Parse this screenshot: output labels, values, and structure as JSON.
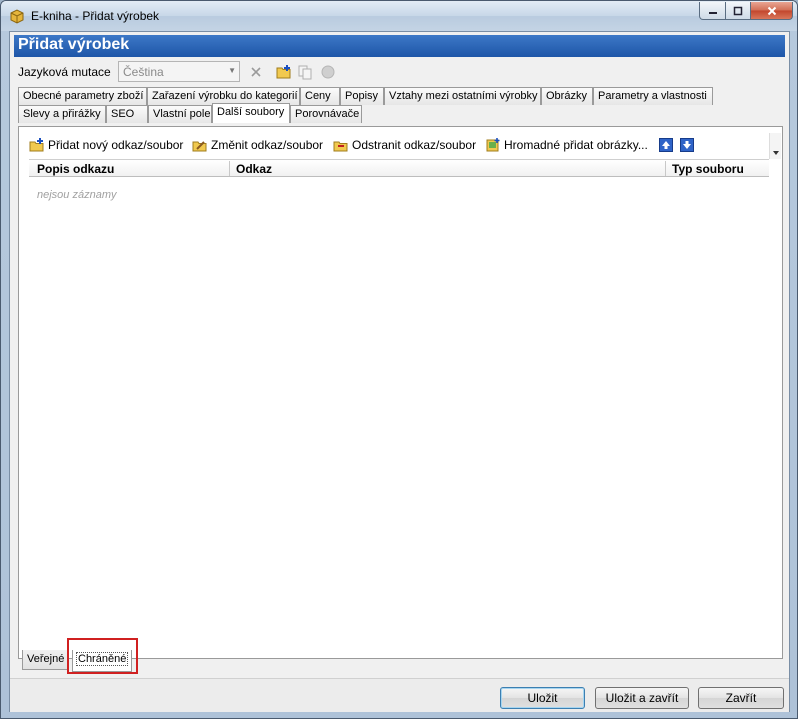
{
  "window": {
    "title": "E-kniha - Přidat výrobek"
  },
  "form": {
    "header": "Přidat výrobek",
    "language_label": "Jazyková mutace",
    "language_value": "Čeština"
  },
  "tabs_row1": [
    {
      "label": "Obecné parametry zboží"
    },
    {
      "label": "Zařazení výrobku do kategorií"
    },
    {
      "label": "Ceny"
    },
    {
      "label": "Popisy"
    },
    {
      "label": "Vztahy mezi ostatními výrobky"
    },
    {
      "label": "Obrázky"
    },
    {
      "label": "Parametry a vlastnosti"
    }
  ],
  "tabs_row2": [
    {
      "label": "Slevy a přirážky"
    },
    {
      "label": "SEO"
    },
    {
      "label": "Vlastní pole"
    },
    {
      "label": "Další soubory"
    },
    {
      "label": "Porovnávače"
    }
  ],
  "active_tab": "Další soubory",
  "toolbar": {
    "add": "Přidat nový odkaz/soubor",
    "edit": "Změnit odkaz/soubor",
    "delete": "Odstranit odkaz/soubor",
    "bulk_add": "Hromadné přidat obrázky..."
  },
  "grid": {
    "columns": [
      "Popis odkazu",
      "Odkaz",
      "Typ souboru"
    ],
    "empty_text": "nejsou záznamy"
  },
  "bottom_tabs": [
    {
      "label": "Veřejné"
    },
    {
      "label": "Chráněné"
    }
  ],
  "active_bottom_tab": "Chráněné",
  "buttons": {
    "save": "Uložit",
    "save_close": "Uložit a zavřít",
    "close": "Zavřít"
  },
  "icons": {
    "app": "package-icon",
    "clear": "x-icon",
    "add_folder": "folder-add-icon",
    "copy": "copy-icon",
    "status": "circle-icon",
    "move_up": "arrow-up-icon",
    "move_down": "arrow-down-icon"
  },
  "colors": {
    "header_blue": "#1e56a8",
    "highlight_red": "#d02020"
  }
}
